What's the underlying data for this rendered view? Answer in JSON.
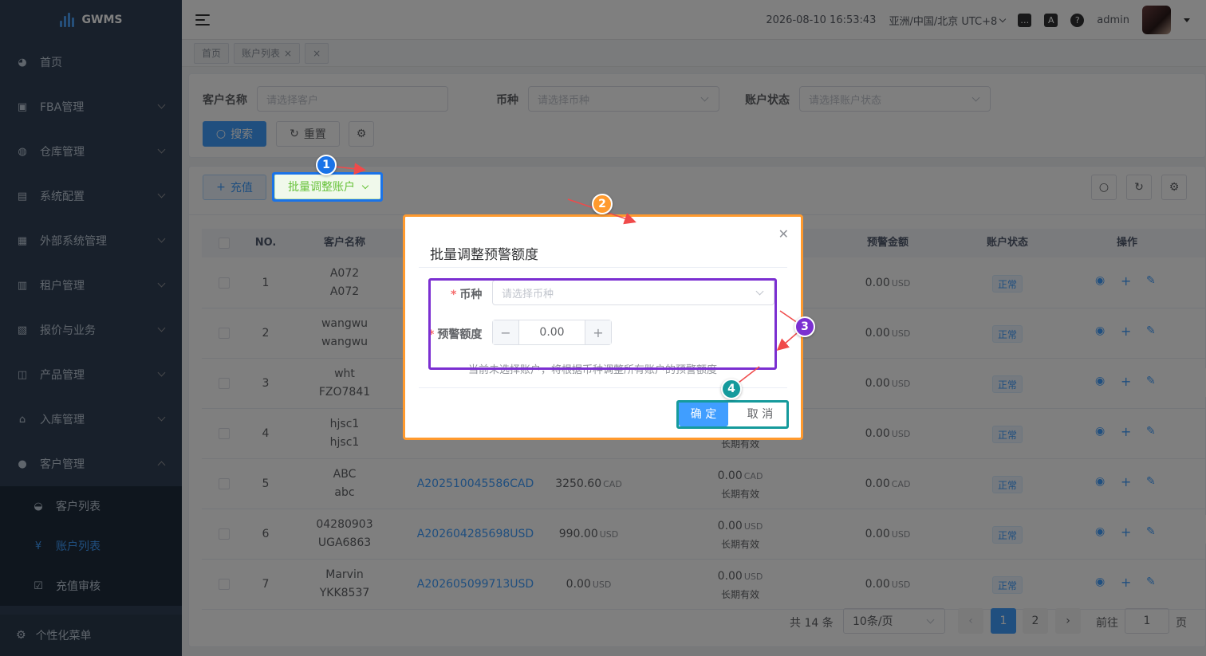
{
  "app": {
    "logo_text": "GWMS"
  },
  "sidebar": {
    "items": [
      {
        "label": "首页",
        "icon": "dashboard-icon",
        "glyph": "◕",
        "has_children": false
      },
      {
        "label": "FBA管理",
        "icon": "box-icon",
        "glyph": "▣",
        "has_children": true
      },
      {
        "label": "仓库管理",
        "icon": "globe-icon",
        "glyph": "◍",
        "has_children": true
      },
      {
        "label": "系统配置",
        "icon": "document-icon",
        "glyph": "▤",
        "has_children": true
      },
      {
        "label": "外部系统管理",
        "icon": "grid-icon",
        "glyph": "▦",
        "has_children": true
      },
      {
        "label": "租户管理",
        "icon": "bar-chart-icon",
        "glyph": "▥",
        "has_children": true
      },
      {
        "label": "报价与业务",
        "icon": "report-icon",
        "glyph": "▧",
        "has_children": true
      },
      {
        "label": "产品管理",
        "icon": "cart-icon",
        "glyph": "◫",
        "has_children": true
      },
      {
        "label": "入库管理",
        "icon": "home-icon",
        "glyph": "⌂",
        "has_children": true
      },
      {
        "label": "客户管理",
        "icon": "user-icon",
        "glyph": "●",
        "has_children": true,
        "expanded": true
      }
    ],
    "sub_items": [
      {
        "label": "客户列表",
        "icon": "customer-icon",
        "glyph": "◒"
      },
      {
        "label": "账户列表",
        "icon": "yen-icon",
        "glyph": "¥",
        "active": true
      },
      {
        "label": "充值审核",
        "icon": "check-square-icon",
        "glyph": "☑"
      }
    ],
    "bottom": {
      "label": "个性化菜单",
      "glyph": "⚙"
    }
  },
  "header": {
    "datetime": "2026-08-10 16:53:43",
    "timezone": "亚洲/中国/北京 UTC+8",
    "username": "admin"
  },
  "tags": [
    {
      "label": "首页",
      "closable": false
    },
    {
      "label": "账户列表",
      "closable": true
    },
    {
      "label": "",
      "closable": true
    }
  ],
  "search": {
    "customer_label": "客户名称",
    "customer_placeholder": "请选择客户",
    "currency_label": "币种",
    "currency_placeholder": "请选择币种",
    "status_label": "账户状态",
    "status_placeholder": "请选择账户状态",
    "search_btn": "搜索",
    "reset_btn": "重置"
  },
  "toolbar": {
    "recharge_btn": "充值",
    "batch_btn": "批量调整账户"
  },
  "table": {
    "headers": {
      "no": "NO.",
      "customer": "客户名称",
      "warning_amount": "预警金额",
      "status": "账户状态",
      "ops": "操作"
    },
    "rows": [
      {
        "no": "1",
        "name1": "A072",
        "name2": "A072",
        "account": "",
        "balance": "",
        "balance_unit": "",
        "credit": "",
        "credit_unit": "",
        "validity": "",
        "warning": "0.00",
        "warning_unit": "USD",
        "status": "正常"
      },
      {
        "no": "2",
        "name1": "wangwu",
        "name2": "wangwu",
        "account": "",
        "balance": "",
        "balance_unit": "",
        "credit": "",
        "credit_unit": "",
        "validity": "",
        "warning": "0.00",
        "warning_unit": "USD",
        "status": "正常"
      },
      {
        "no": "3",
        "name1": "wht",
        "name2": "FZO7841",
        "account": "",
        "balance": "",
        "balance_unit": "",
        "credit": "",
        "credit_unit": "",
        "validity": "",
        "warning": "0.00",
        "warning_unit": "USD",
        "status": "正常"
      },
      {
        "no": "4",
        "name1": "hjsc1",
        "name2": "hjsc1",
        "account": "",
        "balance": "",
        "balance_unit": "",
        "credit": "",
        "credit_unit": "",
        "validity": "长期有效",
        "warning": "0.00",
        "warning_unit": "USD",
        "status": "正常"
      },
      {
        "no": "5",
        "name1": "ABC",
        "name2": "abc",
        "account": "A202510045586CAD",
        "balance": "3250.60",
        "balance_unit": "CAD",
        "credit": "0.00",
        "credit_unit": "CAD",
        "validity": "长期有效",
        "warning": "0.00",
        "warning_unit": "CAD",
        "status": "正常"
      },
      {
        "no": "6",
        "name1": "04280903",
        "name2": "UGA6863",
        "account": "A202604285698USD",
        "balance": "990.00",
        "balance_unit": "USD",
        "credit": "0.00",
        "credit_unit": "USD",
        "validity": "长期有效",
        "warning": "0.00",
        "warning_unit": "USD",
        "status": "正常"
      },
      {
        "no": "7",
        "name1": "Marvin",
        "name2": "YKK8537",
        "account": "A202605099713USD",
        "balance": "0.00",
        "balance_unit": "USD",
        "credit": "0.00",
        "credit_unit": "USD",
        "validity": "长期有效",
        "warning": "0.00",
        "warning_unit": "USD",
        "status": "正常"
      }
    ]
  },
  "pagination": {
    "total": "共 14 条",
    "page_size": "10条/页",
    "pages": [
      "1",
      "2"
    ],
    "current": "1",
    "goto_label": "前往",
    "goto_value": "1",
    "page_suffix": "页"
  },
  "modal": {
    "title": "批量调整预警额度",
    "currency_label": "币种",
    "currency_placeholder": "请选择币种",
    "amount_label": "预警额度",
    "amount_value": "0.00",
    "hint": "当前未选择账户，将根据币种调整所有账户的预警额度",
    "confirm_btn": "确 定",
    "cancel_btn": "取 消"
  },
  "annotations": {
    "badges": [
      "1",
      "2",
      "3",
      "4"
    ],
    "colors": {
      "blue": "#1a73e8",
      "orange": "#ff9a2e",
      "purple": "#7b2fd1",
      "teal": "#159a9c",
      "arrow": "#f04a4a"
    }
  }
}
